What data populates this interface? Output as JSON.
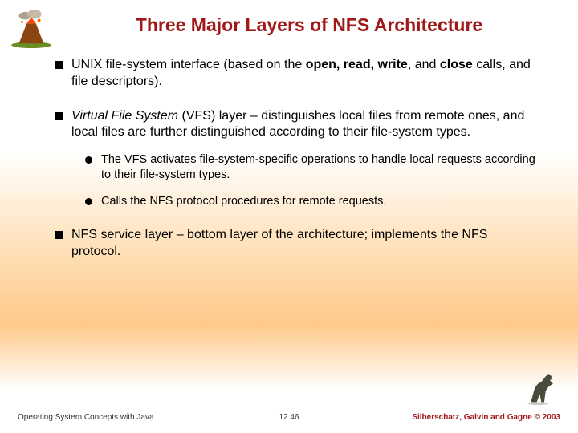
{
  "title": "Three Major Layers of NFS Architecture",
  "bullets": {
    "b1_pre": "UNIX file-system interface (based on the ",
    "b1_bold1": "open, read, write",
    "b1_mid": ", and ",
    "b1_bold2": "close",
    "b1_post": " calls, and file descriptors).",
    "b2_ital": "Virtual File System",
    "b2_post": " (VFS) layer – distinguishes local files from remote ones, and local files are further distinguished according to their file-system types.",
    "b2_sub1": "The VFS activates file-system-specific operations to handle local requests according to their file-system types.",
    "b2_sub2": "Calls the NFS protocol procedures for remote requests.",
    "b3": "NFS service layer – bottom layer of the architecture; implements the NFS protocol."
  },
  "footer": {
    "left": "Operating System Concepts with Java",
    "center": "12.46",
    "right": "Silberschatz, Galvin and Gagne © 2003"
  }
}
